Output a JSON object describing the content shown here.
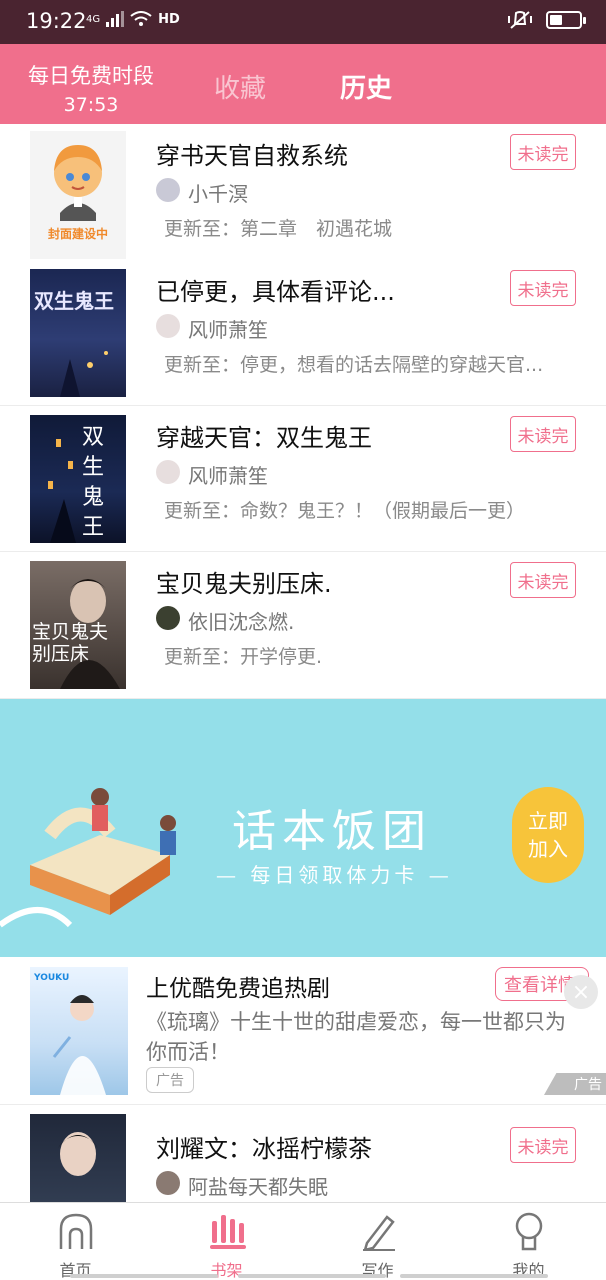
{
  "status_bar": {
    "time": "19:22",
    "network": "4G",
    "wifi": "HD"
  },
  "header": {
    "free_period_label": "每日免费时段",
    "free_period_timer": "37:53",
    "tabs": [
      {
        "label": "收藏",
        "active": false
      },
      {
        "label": "历史",
        "active": true
      }
    ],
    "accent_color": "#f06f8c"
  },
  "books": [
    {
      "title": "穿书天官自救系统",
      "author": "小千溟",
      "update": "更新至：第二章　初遇花城",
      "status": "未读完",
      "cover_caption": "封面建设中"
    },
    {
      "title": "已停更，具体看评论...",
      "author": "风师萧笙",
      "update": "更新至：停更，想看的话去隔壁的穿越天官...",
      "status": "未读完",
      "cover_caption": "双生鬼王"
    },
    {
      "title": "穿越天官：双生鬼王",
      "author": "风师萧笙",
      "update": "更新至：命数？鬼王？！（假期最后一更）",
      "status": "未读完",
      "cover_caption": "双生鬼王"
    },
    {
      "title": "宝贝鬼夫别压床.",
      "author": "依旧沈念燃.",
      "update": "更新至：开学停更.",
      "status": "未读完",
      "cover_caption": "宝贝鬼夫别压床"
    },
    {
      "title": "刘耀文：冰摇柠檬茶",
      "author": "阿盐每天都失眠",
      "update": "",
      "status": "未读完",
      "cover_caption": ""
    }
  ],
  "banner": {
    "title": "话本饭团",
    "subtitle": "— 每日领取体力卡 —",
    "join_line1": "立即",
    "join_line2": "加入"
  },
  "ad": {
    "title": "上优酷免费追热剧",
    "description": "《琉璃》十生十世的甜虐爱恋，每一世都只为你而活！",
    "tag": "广告",
    "detail_button": "查看详情",
    "corner_mark": "广告",
    "cover_brand": "YOUKU"
  },
  "bottom_nav": [
    {
      "label": "首页",
      "icon": "home-icon",
      "active": false
    },
    {
      "label": "书架",
      "icon": "bookshelf-icon",
      "active": true
    },
    {
      "label": "写作",
      "icon": "pencil-icon",
      "active": false
    },
    {
      "label": "我的",
      "icon": "profile-icon",
      "active": false
    }
  ]
}
